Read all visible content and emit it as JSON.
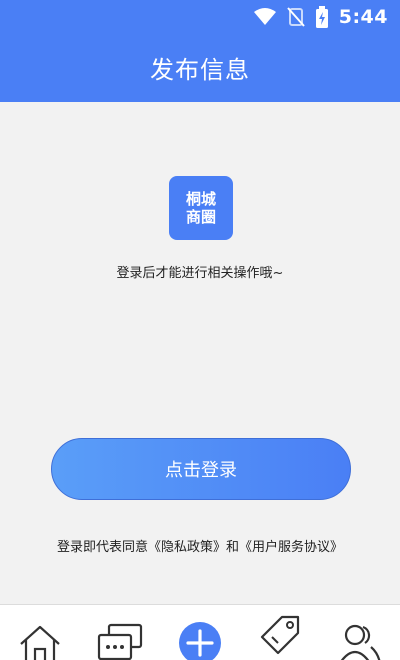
{
  "status": {
    "time": "5:44"
  },
  "header": {
    "title": "发布信息"
  },
  "logo": {
    "line1": "桐城",
    "line2": "商圈"
  },
  "prompt": "登录后才能进行相关操作哦~",
  "login_button": "点击登录",
  "agreement": {
    "prefix": "登录即代表同意",
    "privacy": "《隐私政策》",
    "and": "和",
    "terms": "《用户服务协议》"
  },
  "tabbar": {
    "active_color": "#4a7ff5",
    "tabs": [
      {
        "icon": "home-icon",
        "label": ""
      },
      {
        "icon": "message-icon",
        "label": ""
      },
      {
        "icon": "plus-icon",
        "label": ""
      },
      {
        "icon": "tag-icon",
        "label": ""
      },
      {
        "icon": "users-icon",
        "label": ""
      }
    ]
  }
}
